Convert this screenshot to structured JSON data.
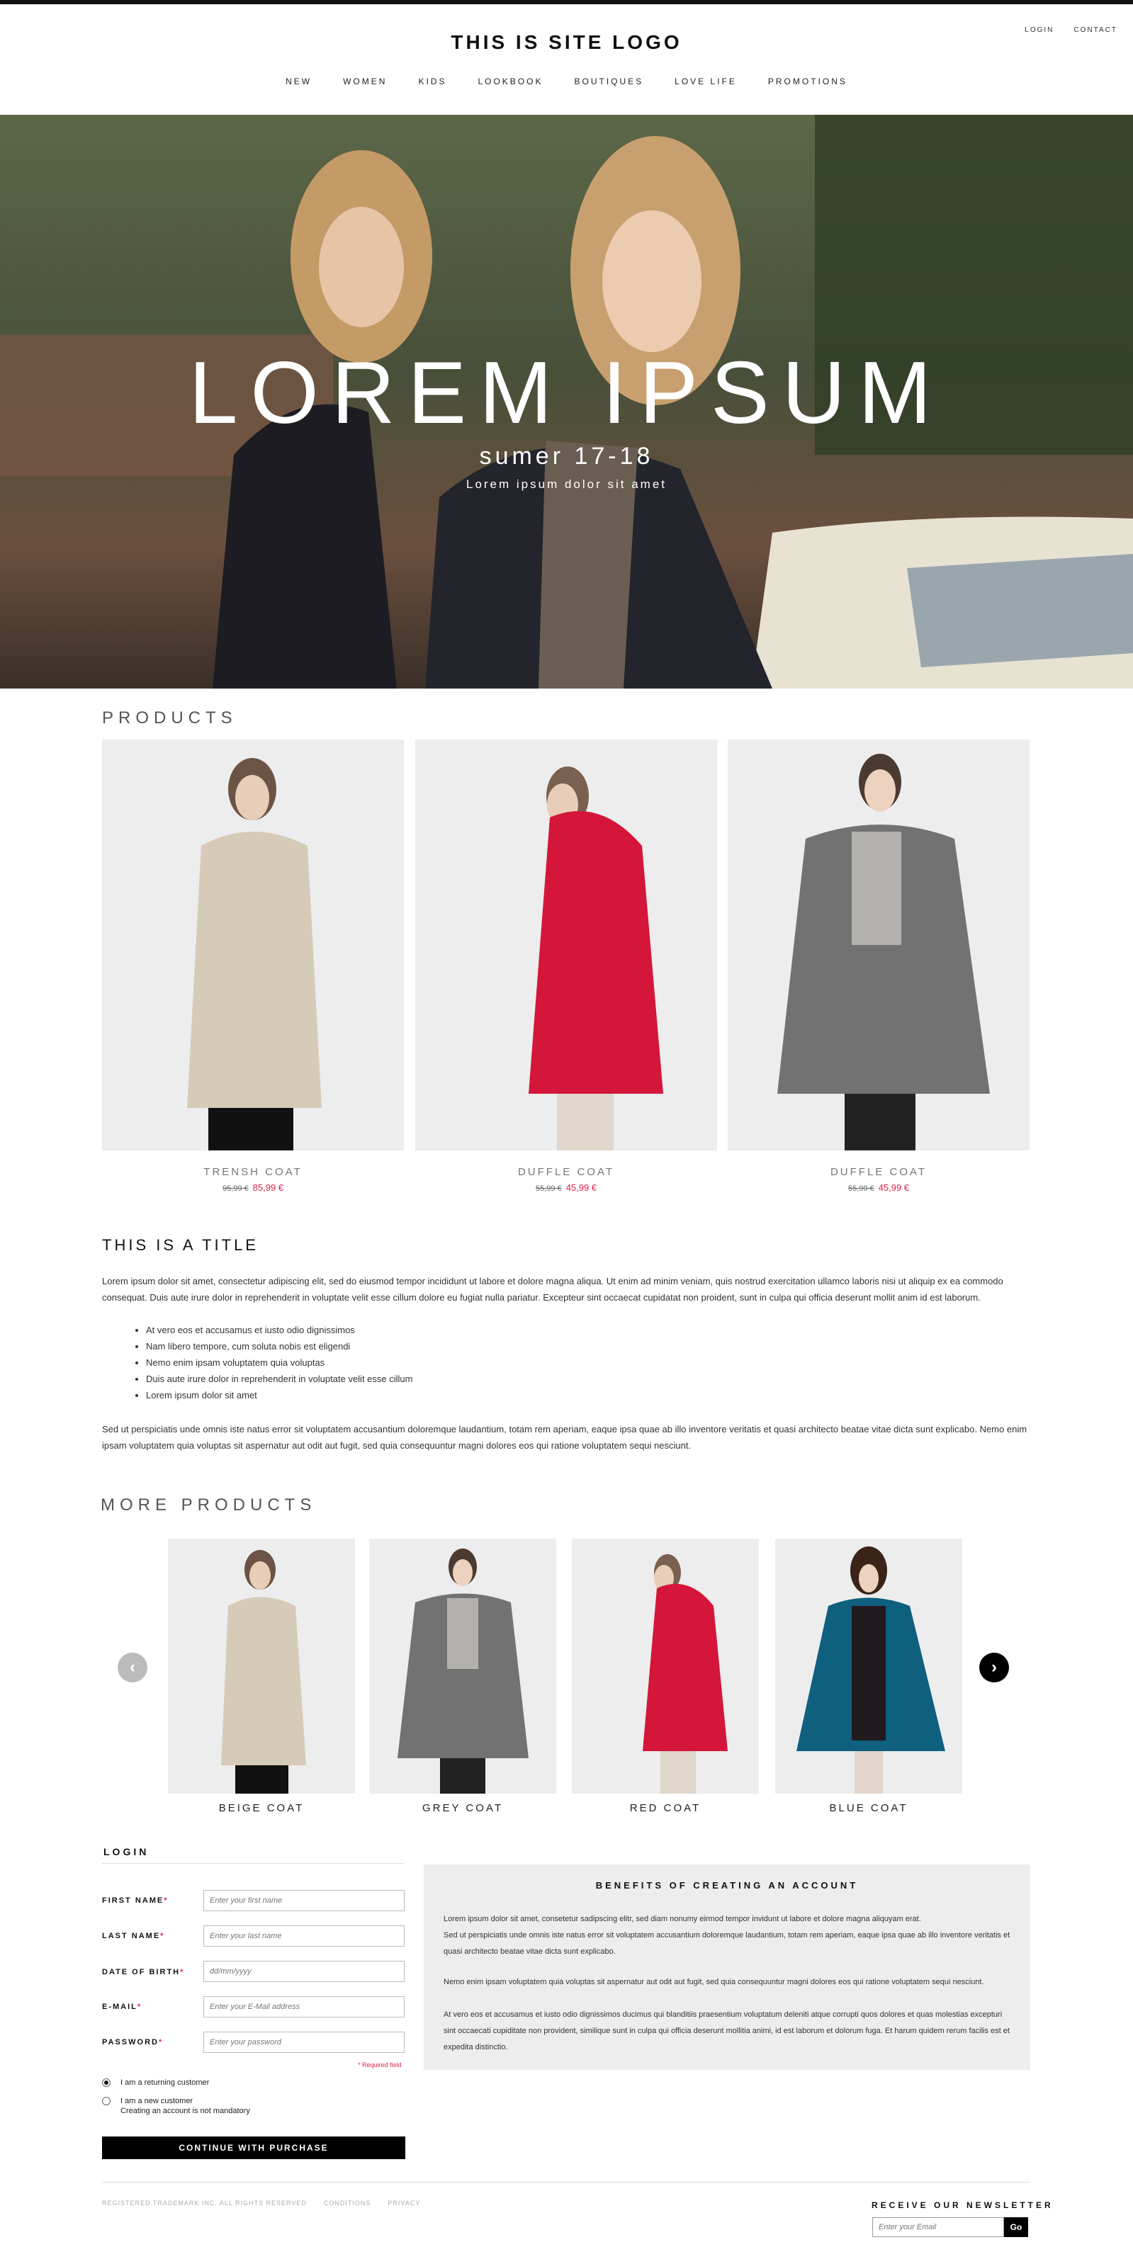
{
  "header": {
    "logo": "THIS IS SITE LOGO",
    "links": [
      "LOGIN",
      "CONTACT"
    ],
    "nav": [
      "NEW",
      "WOMEN",
      "KIDS",
      "LOOKBOOK",
      "BOUTIQUES",
      "LOVE LIFE",
      "PROMOTIONS"
    ]
  },
  "hero": {
    "title": "LOREM IPSUM",
    "subtitle": "sumer 17-18",
    "tagline": "Lorem ipsum dolor sit amet"
  },
  "products": {
    "title": "PRODUCTS",
    "items": [
      {
        "name": "TRENSH COAT",
        "old_price": "95,99 €",
        "price": "85,99 €",
        "color": "#d6cbb8"
      },
      {
        "name": "DUFFLE COAT",
        "old_price": "55,99 €",
        "price": "45,99 €",
        "color": "#d3163a"
      },
      {
        "name": "DUFFLE COAT",
        "old_price": "55,99 €",
        "price": "45,99 €",
        "color": "#727272"
      }
    ]
  },
  "content": {
    "title": "THIS IS A TITLE",
    "para1": "Lorem ipsum dolor sit amet, consectetur adipiscing elit, sed do eiusmod tempor incididunt ut labore et dolore magna aliqua. Ut enim ad minim veniam, quis nostrud exercitation ullamco laboris nisi ut aliquip ex ea commodo consequat. Duis aute irure dolor in reprehenderit in voluptate velit esse cillum dolore eu fugiat nulla pariatur. Excepteur sint occaecat cupidatat non proident, sunt in culpa qui officia deserunt mollit anim id est laborum.",
    "bullets": [
      "At vero eos et accusamus et iusto odio dignissimos",
      "Nam libero tempore, cum soluta nobis est eligendi",
      "Nemo enim ipsam voluptatem quia voluptas",
      "Duis aute irure dolor in reprehenderit in voluptate velit esse cillum",
      "Lorem ipsum dolor sit amet"
    ],
    "para2": "Sed ut perspiciatis unde omnis iste natus error sit voluptatem accusantium doloremque laudantium, totam rem aperiam, eaque ipsa quae ab illo inventore veritatis et quasi architecto beatae vitae dicta sunt explicabo. Nemo enim ipsam voluptatem quia voluptas sit aspernatur aut odit aut fugit, sed quia consequuntur magni dolores eos qui ratione voluptatem sequi nesciunt."
  },
  "more_products": {
    "title": "MORE PRODUCTS",
    "items": [
      {
        "name": "BEIGE COAT",
        "color": "#d6cbb8"
      },
      {
        "name": "GREY COAT",
        "color": "#727272"
      },
      {
        "name": "RED COAT",
        "color": "#d3163a"
      },
      {
        "name": "BLUE COAT",
        "color": "#0f5f7e"
      }
    ]
  },
  "login": {
    "title": "LOGIN",
    "fields": [
      {
        "label": "FIRST NAME",
        "placeholder": "Enter your first name"
      },
      {
        "label": "LAST NAME",
        "placeholder": "Enter your last name"
      },
      {
        "label": "DATE OF BIRTH",
        "placeholder": "dd/mm/yyyy"
      },
      {
        "label": "E-MAIL",
        "placeholder": "Enter your E-Mail address"
      },
      {
        "label": "PASSWORD",
        "placeholder": "Enter your password"
      }
    ],
    "required_star": "*",
    "required_note": "* Required field",
    "radio_returning": "I am a returning customer",
    "radio_new": "I am a new customer",
    "radio_new_note": "Creating an account is not mandatory",
    "continue": "CONTINUE WITH PURCHASE"
  },
  "benefits": {
    "title": "BENEFITS OF CREATING AN ACCOUNT",
    "p1a": "Lorem ipsum dolor sit amet, consetetur sadipscing elitr, sed diam nonumy eirmod tempor invidunt ut labore et dolore magna aliquyam erat.",
    "p1b": "Sed ut perspiciatis unde omnis iste natus error sit voluptatem accusantium doloremque laudantium, totam rem aperiam, eaque ipsa quae ab illo inventore veritatis et quasi architecto beatae vitae dicta sunt explicabo.",
    "p2": "Nemo enim ipsam voluptatem quia voluptas sit aspernatur aut odit aut fugit, sed quia consequuntur magni dolores eos qui ratione voluptatem sequi nesciunt.",
    "p3": "At vero eos et accusamus et iusto odio dignissimos ducimus qui blanditiis praesentium voluptatum deleniti atque corrupti quos dolores et quas molestias excepturi sint occaecati cupiditate non provident, similique sunt in culpa qui officia deserunt mollitia animi, id est laborum et dolorum fuga. Et harum quidem rerum facilis est et expedita distinctio."
  },
  "footer": {
    "copyright": "REGISTERED TRADEMARK INC. ALL RIGHTS RESERVED",
    "conditions": "CONDITIONS",
    "privacy": "PRIVACY",
    "newsletter_title": "RECEIVE OUR NEWSLETTER",
    "newsletter_placeholder": "Enter your Email",
    "newsletter_button": "Go"
  },
  "colors": {
    "accent": "#e0234a",
    "dark": "#000000",
    "panel": "#ededed"
  }
}
